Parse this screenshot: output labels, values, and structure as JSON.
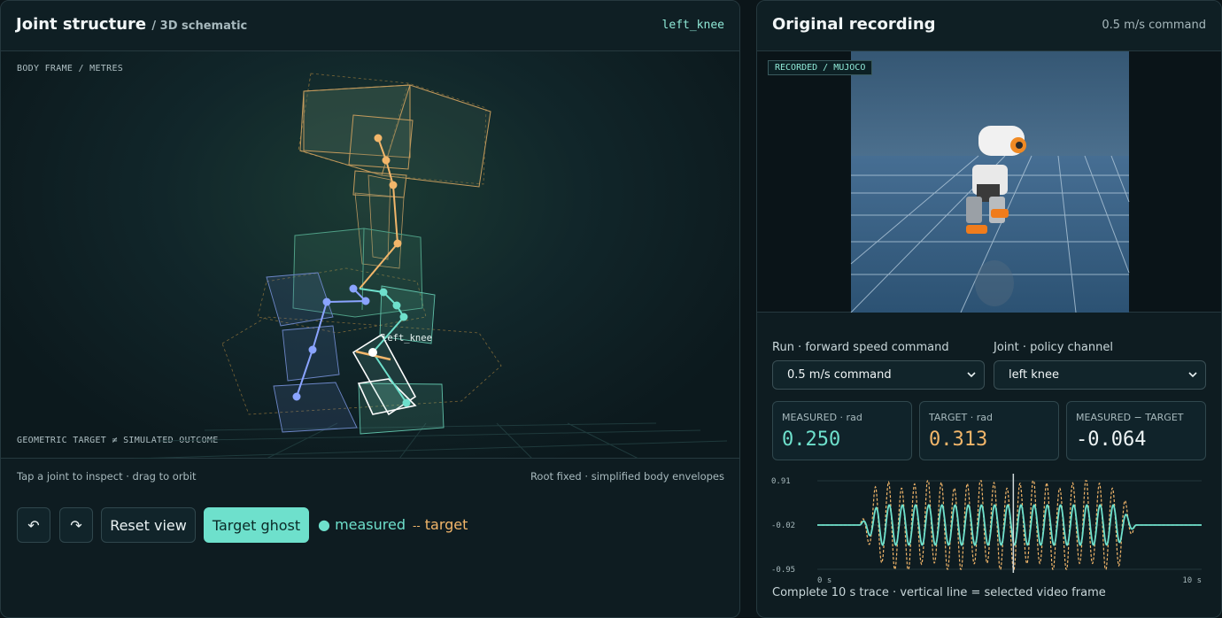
{
  "left_panel": {
    "title": "Joint structure",
    "subtitle": "/ 3D schematic",
    "selected_joint_tag": "left_knee",
    "frame_label": "BODY FRAME / METRES",
    "warning_label": "GEOMETRIC TARGET ≠ SIMULATED OUTCOME",
    "joint_annotation": "left_knee",
    "hint_text": "Tap a joint to inspect · drag to orbit",
    "info_text": "Root fixed · simplified body envelopes",
    "toolbar": {
      "undo_icon": "↶",
      "redo_icon": "↷",
      "reset_label": "Reset view",
      "ghost_label": "Target ghost",
      "legend_measured": "measured",
      "legend_target": "target",
      "legend_target_glyph": "--"
    }
  },
  "right_panel": {
    "title": "Original recording",
    "header_right": "0.5 m/s command",
    "video_tag": "RECORDED / MUJOCO",
    "run_label": "Run · forward speed command",
    "run_value": "0.5 m/s command",
    "joint_label": "Joint · policy channel",
    "joint_value": "left knee",
    "metrics": [
      {
        "label": "MEASURED · rad",
        "value": "0.250",
        "color": "#6ee0cc"
      },
      {
        "label": "TARGET · rad",
        "value": "0.313",
        "color": "#f2b66a"
      },
      {
        "label": "MEASURED − TARGET",
        "value": "-0.064",
        "color": "#eef4f5"
      }
    ],
    "trace_caption": "Complete 10 s trace · vertical line = selected video frame"
  },
  "colors": {
    "measured": "#6ee0cc",
    "target": "#f2b66a",
    "accent": "#6ee0cc"
  },
  "chart_data": {
    "type": "line",
    "x_tick_labels": [
      "0 s",
      "10 s"
    ],
    "y_tick_labels": [
      "0.91",
      "-0.02",
      "-0.95"
    ],
    "xlim": [
      0,
      10
    ],
    "ylim": [
      -0.95,
      0.91
    ],
    "selected_time": 5.1,
    "series": [
      {
        "name": "measured",
        "color": "#6ee0cc",
        "style": "solid"
      },
      {
        "name": "target",
        "color": "#f2b66a",
        "style": "dashed"
      }
    ],
    "gait": {
      "start": 1.1,
      "end": 8.3,
      "cycles": 21,
      "measured_amplitude": 0.42,
      "target_amplitude": 0.88,
      "rest": -0.02
    }
  }
}
